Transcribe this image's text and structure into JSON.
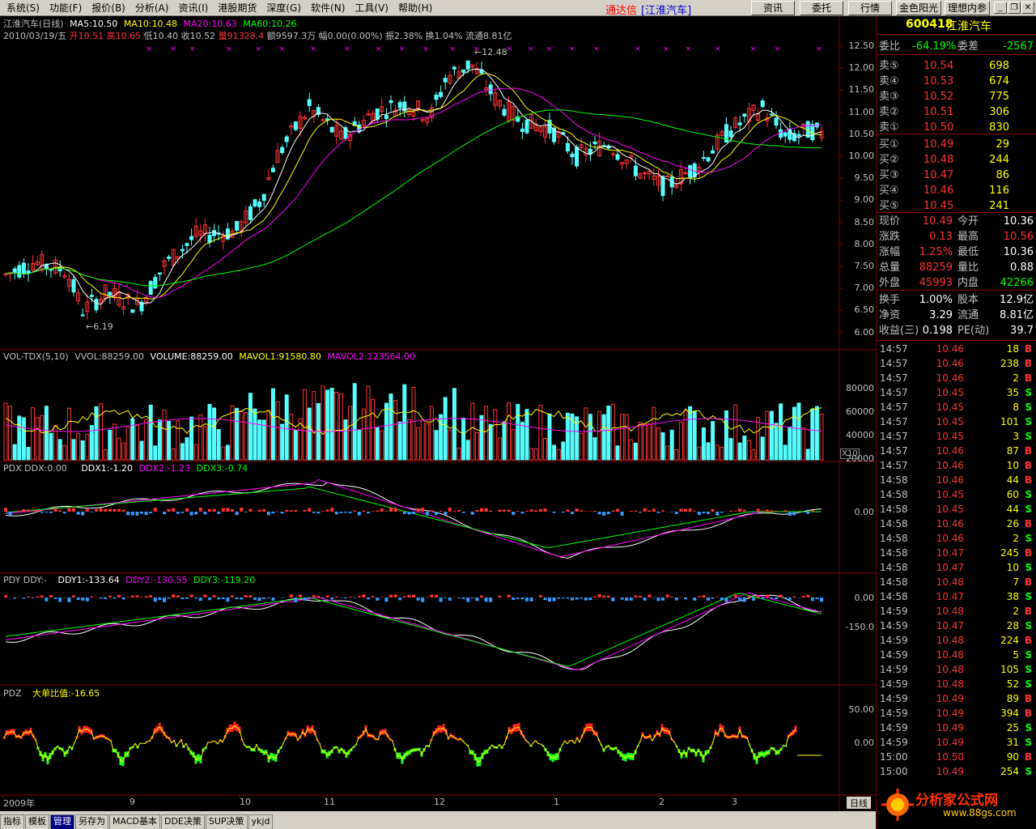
{
  "menu": {
    "items": [
      "系统(S)",
      "功能(F)",
      "报价(B)",
      "分析(A)",
      "资讯(I)",
      "港股期货",
      "深度(G)",
      "软件(N)",
      "工具(V)",
      "帮助(H)"
    ],
    "brand": "通达信",
    "stock_title": "[江淮汽车]",
    "buttons": [
      "资讯",
      "委托",
      "行情",
      "金色阳光",
      "理想内参"
    ]
  },
  "chart": {
    "title": "江淮汽车(日线)",
    "ma5": "MA5:10.50",
    "ma10": "MA10:10.48",
    "ma20": "MA20:10.63",
    "ma60": "MA60:10.26",
    "info_date": "2010/03/19/五",
    "info_open": "开10.51",
    "info_high": "高10.65",
    "info_low": "低10.40",
    "info_close": "收10.52",
    "info_vol": "量91328.4",
    "info_rest": "额9597.3万 幅0.00(0.00%) 振2.38% 换1.04% 流通8.81亿",
    "high_mark": "12.48",
    "low_mark": "6.19",
    "price_axis": [
      "12.50",
      "12.00",
      "11.50",
      "11.00",
      "10.50",
      "10.00",
      "9.50",
      "9.00",
      "8.50",
      "8.00",
      "7.50",
      "7.00",
      "6.50",
      "6.00"
    ],
    "vol_header": "VOL-TDX(5,10)",
    "vol_vvol": "VVOL:88259.00",
    "vol_volume": "VOLUME:88259.00",
    "vol_mavol1": "MAVOL1:91580.80",
    "vol_mavol2": "MAVOL2:123564.00",
    "vol_axis": [
      "80000",
      "60000",
      "40000",
      "20000"
    ],
    "vol_unit": "X10",
    "pdx_header": "PDX DDX:0.00",
    "ddx1": "DDX1:-1.20",
    "ddx2": "DDX2:-1.23",
    "ddx3": "DDX3:-0.74",
    "pdx_axis": [
      "0.00"
    ],
    "pdy_header": "PDY DDY:-",
    "ddy1": "DDY1:-133.64",
    "ddy2": "DDY2:-130.55",
    "ddy3": "DDY3:-119.20",
    "pdy_axis": [
      "0.00",
      "-150.0"
    ],
    "pdz_header": "PDZ",
    "pdz_value": "大单比值:-16.65",
    "pdz_axis": [
      "50.00",
      "0.00"
    ],
    "date_axis": [
      "2009年",
      "9",
      "10",
      "11",
      "12",
      "1",
      "2",
      "3"
    ],
    "period_label": "日线"
  },
  "quote": {
    "code": "600418",
    "name": "江淮汽车",
    "weibi_label": "委比",
    "weibi": "-64.19%",
    "weicha_label": "委差",
    "weicha": "-2567",
    "sells": [
      {
        "label": "卖⑤",
        "price": "10.54",
        "vol": "698"
      },
      {
        "label": "卖④",
        "price": "10.53",
        "vol": "674"
      },
      {
        "label": "卖③",
        "price": "10.52",
        "vol": "775"
      },
      {
        "label": "卖②",
        "price": "10.51",
        "vol": "306"
      },
      {
        "label": "卖①",
        "price": "10.50",
        "vol": "830"
      }
    ],
    "buys": [
      {
        "label": "买①",
        "price": "10.49",
        "vol": "29"
      },
      {
        "label": "买②",
        "price": "10.48",
        "vol": "244"
      },
      {
        "label": "买③",
        "price": "10.47",
        "vol": "86"
      },
      {
        "label": "买④",
        "price": "10.46",
        "vol": "116"
      },
      {
        "label": "买⑤",
        "price": "10.45",
        "vol": "241"
      }
    ],
    "stats": [
      {
        "l1": "现价",
        "v1": "10.49",
        "l2": "今开",
        "v2": "10.36",
        "c2": "#ffffff"
      },
      {
        "l1": "涨跌",
        "v1": "0.13",
        "l2": "最高",
        "v2": "10.56",
        "c2": "#ff3232"
      },
      {
        "l1": "涨幅",
        "v1": "1.25%",
        "l2": "最低",
        "v2": "10.36",
        "c2": "#ffffff"
      },
      {
        "l1": "总量",
        "v1": "88259",
        "l2": "量比",
        "v2": "0.88",
        "c2": "#ffffff"
      },
      {
        "l1": "外盘",
        "v1": "45993",
        "l2": "内盘",
        "v2": "42266",
        "c2": "#00ff00"
      }
    ],
    "stats2": [
      {
        "l1": "换手",
        "v1": "1.00%",
        "l2": "股本",
        "v2": "12.9亿"
      },
      {
        "l1": "净资",
        "v1": "3.29",
        "l2": "流通",
        "v2": "8.81亿"
      },
      {
        "l1": "收益(三)",
        "v1": "0.198",
        "l2": "PE(动)",
        "v2": "39.7"
      }
    ],
    "ticks": [
      {
        "t": "14:57",
        "p": "10.46",
        "v": "18",
        "s": "B"
      },
      {
        "t": "14:57",
        "p": "10.46",
        "v": "238",
        "s": "B"
      },
      {
        "t": "14:57",
        "p": "10.46",
        "v": "2",
        "s": "B"
      },
      {
        "t": "14:57",
        "p": "10.45",
        "v": "35",
        "s": "S"
      },
      {
        "t": "14:57",
        "p": "10.45",
        "v": "8",
        "s": "S"
      },
      {
        "t": "14:57",
        "p": "10.45",
        "v": "101",
        "s": "S"
      },
      {
        "t": "14:57",
        "p": "10.45",
        "v": "3",
        "s": "S"
      },
      {
        "t": "14:57",
        "p": "10.46",
        "v": "87",
        "s": "B"
      },
      {
        "t": "14:57",
        "p": "10.46",
        "v": "10",
        "s": "B"
      },
      {
        "t": "14:58",
        "p": "10.46",
        "v": "44",
        "s": "B"
      },
      {
        "t": "14:58",
        "p": "10.45",
        "v": "60",
        "s": "S"
      },
      {
        "t": "14:58",
        "p": "10.45",
        "v": "44",
        "s": "S"
      },
      {
        "t": "14:58",
        "p": "10.46",
        "v": "26",
        "s": "B"
      },
      {
        "t": "14:58",
        "p": "10.46",
        "v": "2",
        "s": "S"
      },
      {
        "t": "14:58",
        "p": "10.47",
        "v": "245",
        "s": "B"
      },
      {
        "t": "14:58",
        "p": "10.47",
        "v": "10",
        "s": "S"
      },
      {
        "t": "14:58",
        "p": "10.48",
        "v": "7",
        "s": "B"
      },
      {
        "t": "14:58",
        "p": "10.47",
        "v": "38",
        "s": "S"
      },
      {
        "t": "14:59",
        "p": "10.48",
        "v": "2",
        "s": "B"
      },
      {
        "t": "14:59",
        "p": "10.47",
        "v": "28",
        "s": "S"
      },
      {
        "t": "14:59",
        "p": "10.48",
        "v": "224",
        "s": "B"
      },
      {
        "t": "14:59",
        "p": "10.48",
        "v": "5",
        "s": "S"
      },
      {
        "t": "14:59",
        "p": "10.48",
        "v": "105",
        "s": "S"
      },
      {
        "t": "14:59",
        "p": "10.48",
        "v": "52",
        "s": "S"
      },
      {
        "t": "14:59",
        "p": "10.49",
        "v": "89",
        "s": "B"
      },
      {
        "t": "14:59",
        "p": "10.49",
        "v": "394",
        "s": "B"
      },
      {
        "t": "14:59",
        "p": "10.49",
        "v": "25",
        "s": "S"
      },
      {
        "t": "14:59",
        "p": "10.49",
        "v": "31",
        "s": "S"
      },
      {
        "t": "15:00",
        "p": "10.50",
        "v": "90",
        "s": "B"
      },
      {
        "t": "15:00",
        "p": "10.49",
        "v": "254",
        "s": "S"
      },
      {
        "t": "15:00",
        "p": "10.49",
        "v": "",
        "s": ""
      }
    ],
    "watermark": "分析家公式网",
    "watermark_url": "www.88gs.com"
  },
  "bottom_tabs": [
    "指标",
    "模板",
    "管理",
    "另存为",
    "MACD基本",
    "DDE决策",
    "SUP决策",
    "ykjd"
  ],
  "colors": {
    "up": "#ff3232",
    "down": "#54ffff",
    "ma5": "#ffffff",
    "ma10": "#ffff00",
    "ma20": "#ff00ff",
    "ma60": "#00ff00"
  }
}
